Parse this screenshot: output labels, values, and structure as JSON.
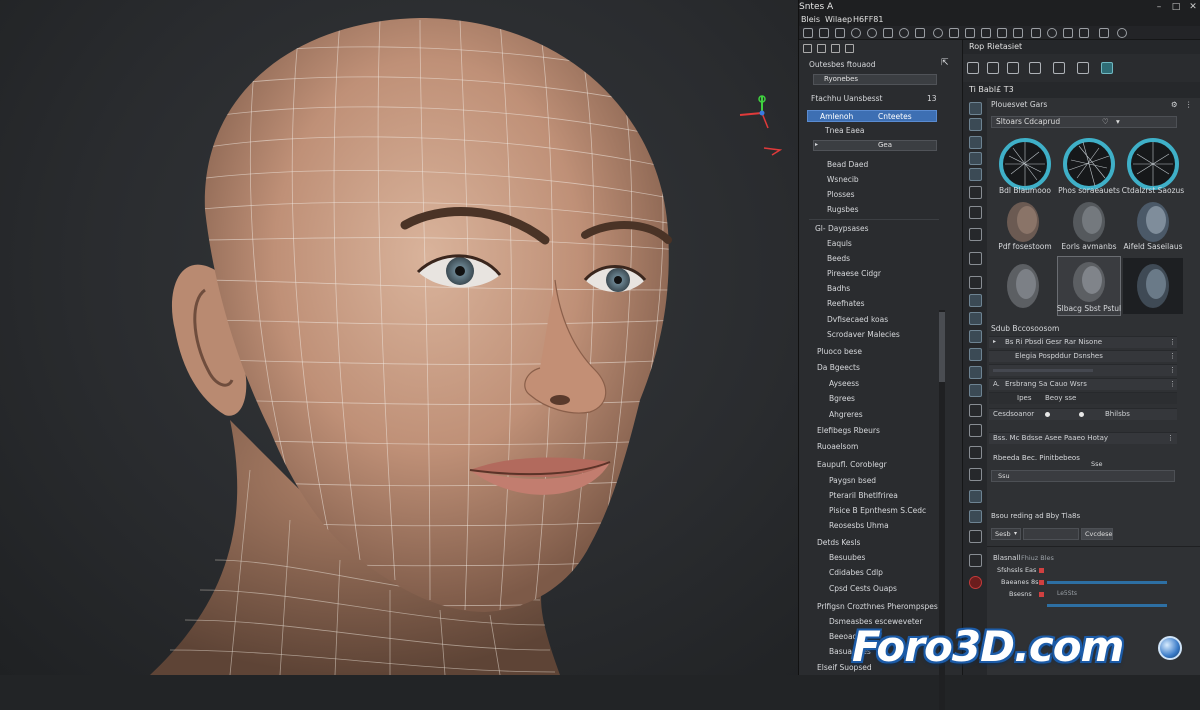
{
  "app": {
    "title": "Sntes A"
  },
  "menu": [
    "Bleis",
    "Wilaep",
    "H6FF81"
  ],
  "left_panel": {
    "header_text": "Outesbes ftouaod",
    "field_1": "Ryonebes",
    "section_title": "Ftachhu Uansbesst",
    "section_count": "13",
    "selected_left": "Amlenoh",
    "selected_right": "Cnteetes",
    "item_after_sel": "Tnea Eaea",
    "field_2": "Gea",
    "group_a": [
      "Bead Daed",
      "Wsnecib",
      "Plosses",
      "Rugsbes"
    ],
    "group_b_title": "Gl- Daypsases",
    "group_b": [
      "Eaquls",
      "Beeds",
      "Pireaese Cidgr",
      "Badhs",
      "Reefhates",
      "Dvfisecaed koas",
      "Scrodaver Malecies"
    ],
    "group_c_title": "Pluoco bese",
    "group_d_title": "Da Bgeects",
    "group_d": [
      "Ayseess",
      "Bgrees",
      "Ahgreres"
    ],
    "group_e_title": "Elefibegs Rbeurs",
    "group_f_title": "Ruoaelsom",
    "group_g_title": "Eaupufl. Coroblegr",
    "group_g": [
      "Paygsn bsed",
      "Pteraril Bhetlfrirea",
      "Pisice B Epnthesm S.Cedc",
      "Reosesbs Uhma"
    ],
    "group_h_title": "Detds Kesls",
    "group_h": [
      "Besuubes",
      "Cdidabes Cdlp",
      "Cpsd Cests Ouaps"
    ],
    "group_i_title": "Prlfigsn Crozthnes Pherompspes",
    "group_i": [
      "Dsmeasbes esceweveter",
      "Beeoaded",
      "Basuarfaes"
    ],
    "group_j_title": "Elseif Suopsed"
  },
  "right_panel": {
    "header_left": "Rop",
    "header_right": "Rietasiet",
    "tab_label": "Ti Babl£ T3",
    "panel_title": "Plouesvet Gars",
    "dropdown_left": "Sltoars",
    "dropdown_right": "Cdcaprud",
    "thumbnails_row1": [
      "Bdl Blaumooo",
      "Phos soraeauets",
      "Ctdalzrst Saozus"
    ],
    "thumbnails_row2": [
      "Pdf fosestoom",
      "Eorls avmanbs",
      "Aifeld Saseilaus"
    ],
    "thumbnails_row3_label": "Slbacg Sbst Pstul",
    "section_label": "Sdub Bccosoosom",
    "props": [
      "Bs Ri Pbsdi Gesr Rar Nisone",
      "Elegia Pospddur Dsnshes",
      "Ersbrang Sa Cauo Wsrs",
      "Ipes",
      "Beoy sse",
      "Cesdsoanor",
      "Bhilsbs"
    ],
    "prop_long": "Bss. Mc Bdsse Asee Paaeo Hotay",
    "prop_sub": "Rbeeda Bec. Pinitbebeos",
    "prop_field": "Sse",
    "prop_field2": "Ssu",
    "prop_section2": "Bsou reding ad Bby Tla8s",
    "dropdown_small": "Sesb",
    "button_small": "Cvcdese",
    "footer_title": "Blasnall",
    "footer_tag": "Fhiuz Bles",
    "footer_rows": [
      "Sfshssls Eas",
      "Baeanes 8s",
      "Bsesns"
    ],
    "footer_mid": "Le5Sts"
  },
  "watermark": "Foro3D.com"
}
